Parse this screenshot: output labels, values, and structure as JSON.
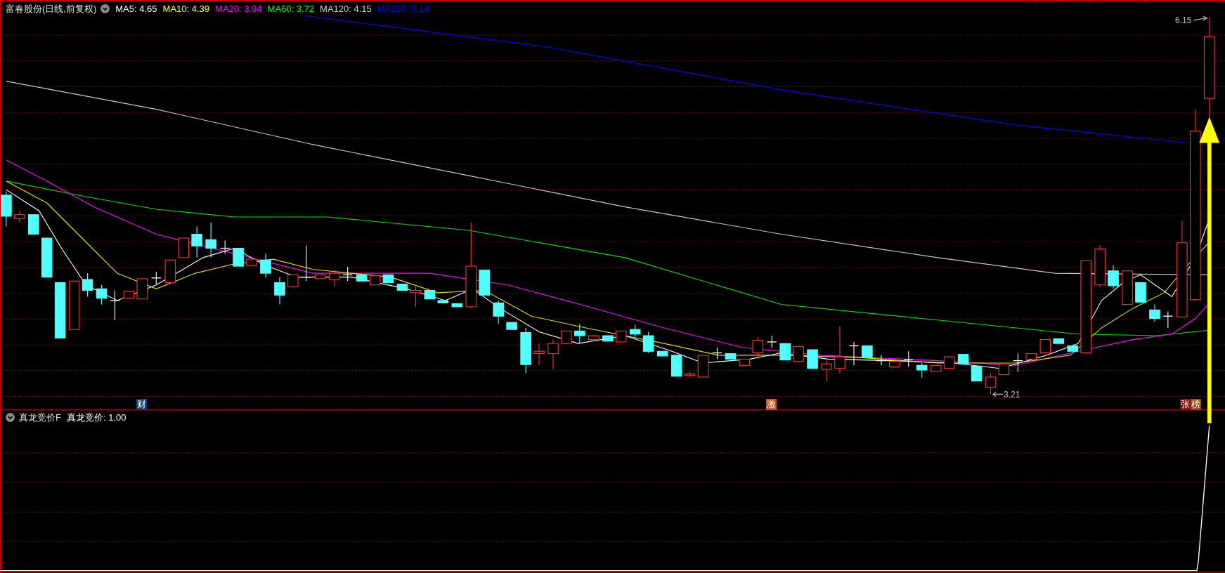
{
  "main_panel": {
    "title": "富春股份(日线,前复权)",
    "indicators": [
      {
        "label": "MA5: 4.65",
        "color": "#ffffff"
      },
      {
        "label": "MA10: 4.39",
        "color": "#ffff00"
      },
      {
        "label": "MA20: 3.94",
        "color": "#ff00ff"
      },
      {
        "label": "MA60: 3.72",
        "color": "#00ff00"
      },
      {
        "label": "MA120: 4.15",
        "color": "#d0d0d0"
      },
      {
        "label": "MA250: 5.14",
        "color": "#0000ff"
      }
    ],
    "high_label": "6.15",
    "low_label": "3.21",
    "markers": [
      {
        "text": "财",
        "color": "#0f3f78"
      },
      {
        "text": "激",
        "color": "#c0501a"
      },
      {
        "text": "张",
        "color": "#8b0a0a"
      },
      {
        "text": "榜",
        "color": "#8b4a10"
      }
    ]
  },
  "sub_panel": {
    "title": "真龙竞价F",
    "value_label": "真龙竞价: 1.00"
  }
}
